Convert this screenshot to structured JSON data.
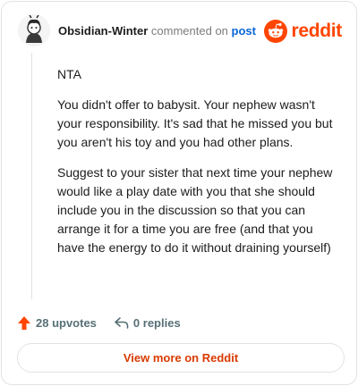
{
  "comment": {
    "username": "Obsidian-Winter",
    "verb": "commented on",
    "post_link": "post",
    "paragraphs": [
      "NTA",
      "You didn't offer to babysit. Your nephew wasn't your responsibility. It's sad that he missed you but you aren't his toy and you had other plans.",
      "Suggest to your sister that next time your nephew would like a play date with you that she should include you in the discussion so that you can arrange it for a time you are free (and that you have the energy to do it without draining yourself)"
    ]
  },
  "brand": {
    "name": "reddit",
    "icon": "reddit-snoo-icon",
    "color": "#ff4500"
  },
  "actions": {
    "upvotes": "28 upvotes",
    "upvote_icon": "upvote-arrow-icon",
    "replies": "0 replies",
    "reply_icon": "reply-arrow-icon"
  },
  "footer": {
    "view_more_label": "View more on Reddit",
    "accent": "#d93a00"
  }
}
